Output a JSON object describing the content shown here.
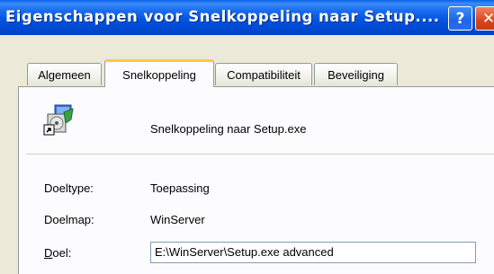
{
  "window": {
    "title": "Eigenschappen voor Snelkoppeling naar Setup....",
    "help_label": "?",
    "close_label": "✕"
  },
  "tabs": [
    {
      "label": "Algemeen",
      "active": false
    },
    {
      "label": "Snelkoppeling",
      "active": true
    },
    {
      "label": "Compatibiliteit",
      "active": false
    },
    {
      "label": "Beveiliging",
      "active": false
    }
  ],
  "shortcut": {
    "icon": "setup-shortcut-icon",
    "name": "Snelkoppeling naar Setup.exe",
    "doeltype_label": "Doeltype:",
    "doeltype_value": "Toepassing",
    "doelmap_label": "Doelmap:",
    "doelmap_value": "WinServer",
    "doel_label_accel": "D",
    "doel_label_rest": "oel:",
    "doel_value": "E:\\WinServer\\Setup.exe advanced"
  },
  "colors": {
    "titlebar": "#0054e3",
    "active_tab_accent": "#ffc83c",
    "close_button": "#d8461f",
    "dialog_bg": "#ece9d8"
  }
}
